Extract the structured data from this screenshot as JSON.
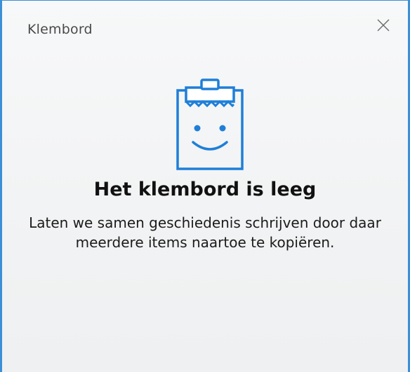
{
  "window": {
    "title": "Klembord",
    "close_icon": "close-icon"
  },
  "empty_state": {
    "icon": "smiling-clipboard-icon",
    "heading": "Het klembord is leeg",
    "description": "Laten we samen geschiedenis schrijven door daar meerdere items naartoe te kopiëren."
  },
  "colors": {
    "accent": "#3c8fd6",
    "icon_blue": "#1e7fd8"
  }
}
